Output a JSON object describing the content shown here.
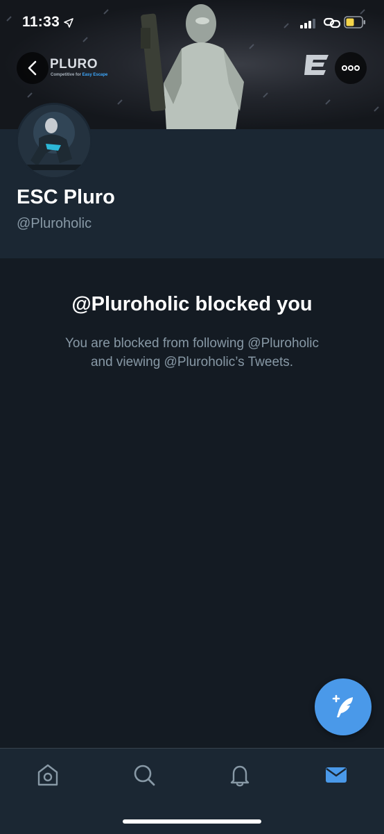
{
  "status_bar": {
    "time": "11:33"
  },
  "banner": {
    "brand_title": "PLURO",
    "brand_sub_prefix": "Competitive for ",
    "brand_sub_accent": "Easy Escape"
  },
  "profile": {
    "display_name": "ESC Pluro",
    "handle": "@Pluroholic"
  },
  "blocked": {
    "title": "@Pluroholic blocked you",
    "message_line1": "You are blocked from following @Pluroholic",
    "message_line2": "and viewing @Pluroholic’s Tweets."
  },
  "tabs": [
    {
      "icon": "home-icon",
      "active": false
    },
    {
      "icon": "search-icon",
      "active": false
    },
    {
      "icon": "bell-icon",
      "active": false
    },
    {
      "icon": "mail-icon",
      "active": true
    }
  ],
  "colors": {
    "background": "#141b23",
    "surface": "#1b2733",
    "accent": "#4a99e9",
    "secondary_text": "#8899a6"
  }
}
